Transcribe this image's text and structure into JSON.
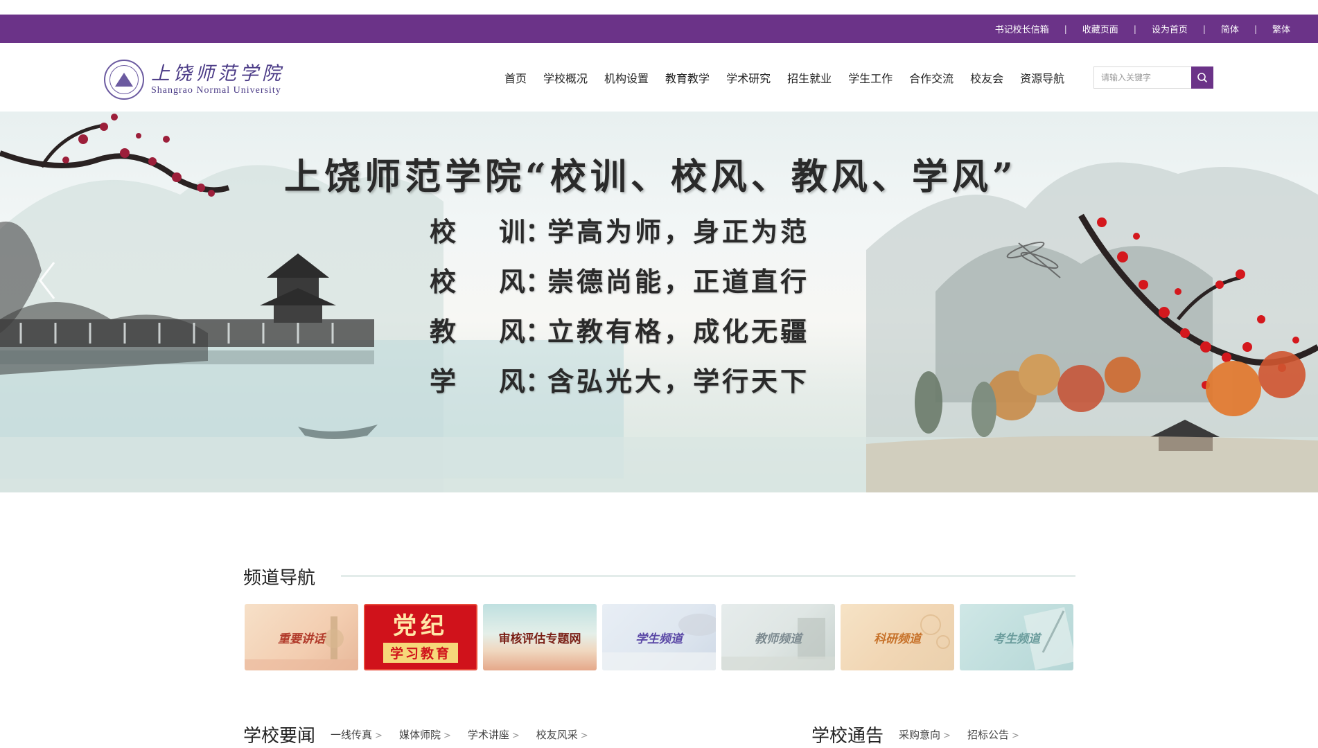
{
  "topbar": {
    "links": [
      "书记校长信箱",
      "收藏页面",
      "设为首页",
      "简体",
      "繁体"
    ],
    "separator": "|"
  },
  "logo": {
    "name_cn": "上饶师范学院",
    "name_en": "Shangrao Normal University"
  },
  "nav": {
    "items": [
      "首页",
      "学校概况",
      "机构设置",
      "教育教学",
      "学术研究",
      "招生就业",
      "学生工作",
      "合作交流",
      "校友会",
      "资源导航"
    ]
  },
  "search": {
    "placeholder": "请输入关键字",
    "icon": "search-icon"
  },
  "banner": {
    "title": "上饶师范学院“校训、校风、教风、学风”",
    "mottos": [
      {
        "k1": "校",
        "k2": "训：",
        "value": "学高为师，身正为范"
      },
      {
        "k1": "校",
        "k2": "风：",
        "value": "崇德尚能，正道直行"
      },
      {
        "k1": "教",
        "k2": "风：",
        "value": "立教有格，成化无疆"
      },
      {
        "k1": "学",
        "k2": "风：",
        "value": "含弘光大，学行天下"
      }
    ],
    "prev_icon": "chevron-left-icon"
  },
  "channel_nav": {
    "title": "频道导航",
    "channels": [
      {
        "label": "重要讲话",
        "color": "#a83a2a"
      },
      {
        "label1": "党纪",
        "label2": "学习教育",
        "color": "#d0121b"
      },
      {
        "label": "审核评估专题网",
        "color": "#8a2a1a"
      },
      {
        "label": "学生频道",
        "color": "#5a4aa0"
      },
      {
        "label": "教师频道",
        "color": "#7a8a90"
      },
      {
        "label": "科研频道",
        "color": "#c8742a"
      },
      {
        "label": "考生频道",
        "color": "#6a9a9a"
      }
    ]
  },
  "news": {
    "title": "学校要闻",
    "sublinks": [
      "一线传真",
      "媒体师院",
      "学术讲座",
      "校友风采"
    ],
    "arrow": ">"
  },
  "notices": {
    "title": "学校通告",
    "sublinks": [
      "采购意向",
      "招标公告"
    ],
    "arrow": ">"
  }
}
